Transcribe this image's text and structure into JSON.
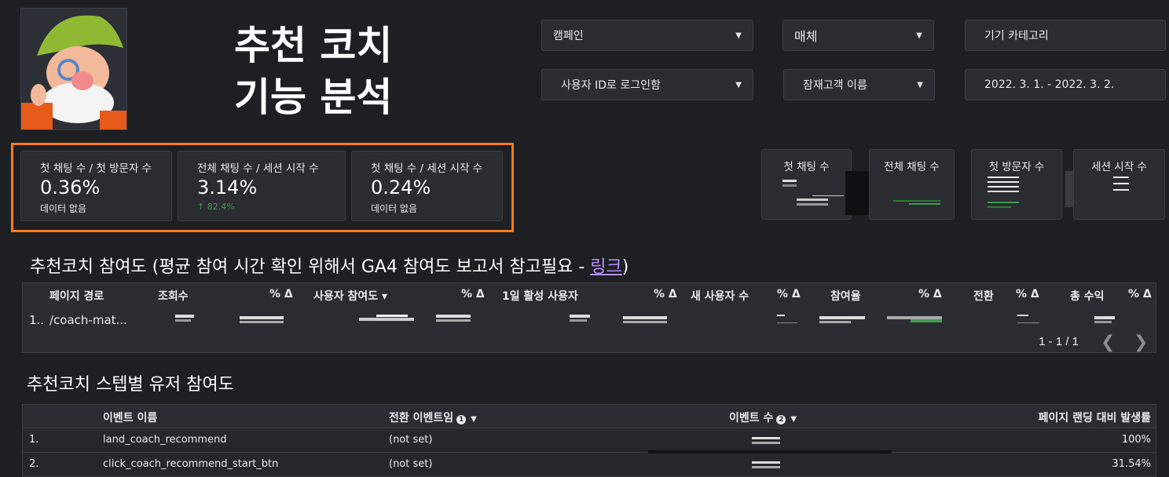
{
  "title_line1": "추천 코치",
  "title_line2": "기능 분석",
  "filters": {
    "campaign": "캠페인",
    "medium": "매체",
    "device": "기기 카테고리",
    "user_id": "사용자 ID로 로그인함",
    "audience": "잠재고객 이름",
    "date_range": "2022. 3. 1. - 2022. 3. 2."
  },
  "kpis": [
    {
      "label": "첫 채팅 수 / 첫 방문자 수",
      "value": "0.36%",
      "sub": "데이터 없음"
    },
    {
      "label": "전체 채팅 수 / 세션 시작 수",
      "value": "3.14%",
      "sub": "↑ 82.4%"
    },
    {
      "label": "첫 채팅 수 / 세션 시작 수",
      "value": "0.24%",
      "sub": "데이터 없음"
    }
  ],
  "sparks": [
    {
      "label": "첫 채팅 수"
    },
    {
      "label": "전체 채팅 수"
    },
    {
      "label": "첫 방문자 수"
    },
    {
      "label": "세션 시작 수"
    }
  ],
  "section1": {
    "title": "추천코치 참여도 (평균 참여 시간 확인 위해서 GA4 참여도 보고서 참고필요 - ",
    "link": "링크",
    "title_end": ")"
  },
  "table1": {
    "headers": [
      "페이지 경로",
      "조회수",
      "% Δ",
      "사용자 참여도 ▾",
      "% Δ",
      "1일 활성 사용자",
      "% Δ",
      "새 사용자 수",
      "% Δ",
      "참여율",
      "% Δ",
      "전환",
      "% Δ",
      "총 수익",
      "% Δ"
    ],
    "row": {
      "index": "1..",
      "path": "/coach-mat..."
    },
    "pager": "1 - 1 / 1"
  },
  "section2": {
    "title": "추천코치 스텝별 유저 참여도"
  },
  "table2": {
    "headers": {
      "event": "이벤트 이름",
      "conv": "전환 이벤트임",
      "count": "이벤트 수",
      "rate": "페이지 랜딩 대비 발생률"
    },
    "rows": [
      {
        "index": "1.",
        "event": "land_coach_recommend",
        "conv": "(not set)",
        "rate": "100%"
      },
      {
        "index": "2.",
        "event": "click_coach_recommend_start_btn",
        "conv": "(not set)",
        "rate": "31.54%"
      }
    ]
  },
  "colors": {
    "background": "#1d1f23",
    "card": "#2a2c32",
    "highlight": "#ff7a1a",
    "link": "#b48dff",
    "positive": "#3f9a4f"
  }
}
